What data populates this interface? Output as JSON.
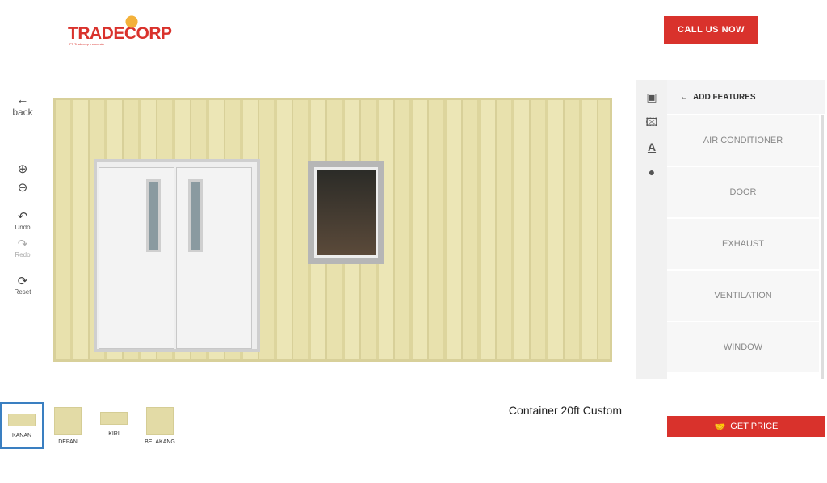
{
  "header": {
    "logo": "TRADECORP",
    "logo_sub": "PT Tradecorp Indonesia",
    "call_label": "CALL US NOW"
  },
  "tools": {
    "back": "back",
    "zoom_in": "zoom-in",
    "zoom_out": "zoom-out",
    "undo": "Undo",
    "redo": "Redo",
    "reset": "Reset"
  },
  "panel": {
    "header": "ADD FEATURES",
    "features": [
      "AIR CONDITIONER",
      "DOOR",
      "EXHAUST",
      "VENTILATION",
      "WINDOW"
    ]
  },
  "product": {
    "title": "Container 20ft Custom",
    "get_price": "GET PRICE"
  },
  "views": [
    "KANAN",
    "DEPAN",
    "KIRI",
    "BELAKANG"
  ],
  "colors": {
    "accent": "#d9322c",
    "container": "#e6dfa9",
    "selected": "#3a7fc1"
  }
}
